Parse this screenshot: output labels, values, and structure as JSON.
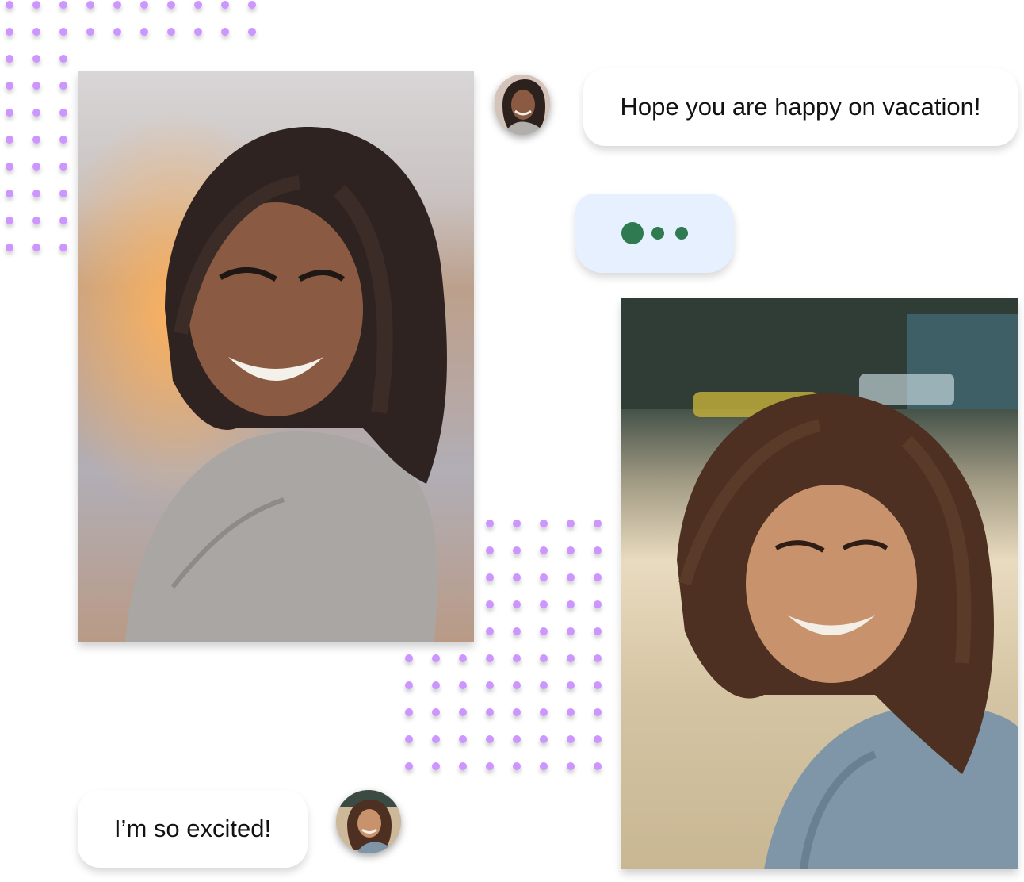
{
  "messages": {
    "top_text": "Hope you are happy on vacation!",
    "bottom_text": "I’m so excited!"
  },
  "colors": {
    "dot": "#cc95ff",
    "typing_bubble": "#e6f0fe",
    "typing_dots": "#2f7a50"
  },
  "icons": {
    "avatar_top": "profile-avatar",
    "avatar_bottom": "profile-avatar"
  }
}
